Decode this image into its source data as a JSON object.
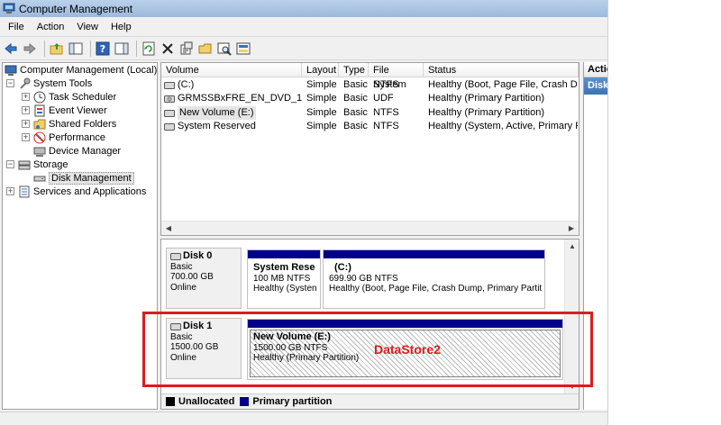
{
  "window": {
    "title": "Computer Management"
  },
  "menu": [
    "File",
    "Action",
    "View",
    "Help"
  ],
  "tree": {
    "root": "Computer Management (Local)",
    "system_tools": "System Tools",
    "task_scheduler": "Task Scheduler",
    "event_viewer": "Event Viewer",
    "shared_folders": "Shared Folders",
    "performance": "Performance",
    "device_manager": "Device Manager",
    "storage": "Storage",
    "disk_management": "Disk Management",
    "services": "Services and Applications"
  },
  "volumes": {
    "headers": {
      "volume": "Volume",
      "layout": "Layout",
      "type": "Type",
      "fs": "File System",
      "status": "Status"
    },
    "rows": [
      {
        "volume": "(C:)",
        "layout": "Simple",
        "type": "Basic",
        "fs": "NTFS",
        "status": "Healthy (Boot, Page File, Crash Dump"
      },
      {
        "volume": "GRMSSBxFRE_EN_DVD_1 (D:)",
        "layout": "Simple",
        "type": "Basic",
        "fs": "UDF",
        "status": "Healthy (Primary Partition)"
      },
      {
        "volume": "New Volume (E:)",
        "layout": "Simple",
        "type": "Basic",
        "fs": "NTFS",
        "status": "Healthy (Primary Partition)"
      },
      {
        "volume": "System Reserved",
        "layout": "Simple",
        "type": "Basic",
        "fs": "NTFS",
        "status": "Healthy (System, Active, Primary Part"
      }
    ]
  },
  "disks": {
    "disk0": {
      "name": "Disk 0",
      "type": "Basic",
      "size": "700.00 GB",
      "state": "Online",
      "p1": {
        "name": "System Rese",
        "size": "100 MB NTFS",
        "status": "Healthy (Systen"
      },
      "p2": {
        "name": "(C:)",
        "size": "699.90 GB NTFS",
        "status": "Healthy (Boot, Page File, Crash Dump, Primary Partit"
      }
    },
    "disk1": {
      "name": "Disk 1",
      "type": "Basic",
      "size": "1500.00 GB",
      "state": "Online",
      "p1": {
        "name": "New Volume  (E:)",
        "size": "1500.00 GB NTFS",
        "status": "Healthy (Primary Partition)"
      }
    }
  },
  "legend": {
    "unallocated": "Unallocated",
    "primary": "Primary partition"
  },
  "actions": {
    "header": "Actio",
    "item": "Disk"
  },
  "annotation": "DataStore2",
  "colors": {
    "primary_partition": "#00008b",
    "unallocated": "#000000",
    "highlight": "#e01b1b"
  }
}
